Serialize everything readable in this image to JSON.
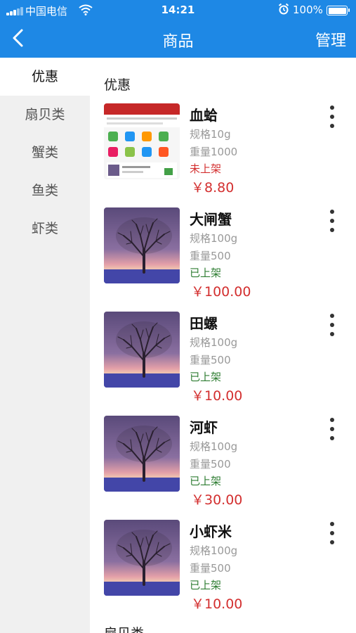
{
  "status_bar": {
    "carrier": "中国电信",
    "time": "14:21",
    "battery": "100%"
  },
  "nav": {
    "title": "商品",
    "manage_label": "管理"
  },
  "sidebar": {
    "categories": [
      {
        "label": "优惠",
        "active": true
      },
      {
        "label": "扇贝类",
        "active": false
      },
      {
        "label": "蟹类",
        "active": false
      },
      {
        "label": "鱼类",
        "active": false
      },
      {
        "label": "虾类",
        "active": false
      }
    ]
  },
  "main": {
    "section_title": "优惠",
    "next_section_title": "扇贝类",
    "products": [
      {
        "name": "血蛤",
        "spec": "规格10g",
        "weight": "重量1000",
        "status": "未上架",
        "status_color": "#d32f2f",
        "price": "￥8.80",
        "thumb": "screenshot"
      },
      {
        "name": "大闸蟹",
        "spec": "规格100g",
        "weight": "重量500",
        "status": "已上架",
        "status_color": "#2e7d32",
        "price": "￥100.00",
        "thumb": "tree"
      },
      {
        "name": "田螺",
        "spec": "规格100g",
        "weight": "重量500",
        "status": "已上架",
        "status_color": "#2e7d32",
        "price": "￥10.00",
        "thumb": "tree"
      },
      {
        "name": "河虾",
        "spec": "规格100g",
        "weight": "重量500",
        "status": "已上架",
        "status_color": "#2e7d32",
        "price": "￥30.00",
        "thumb": "tree"
      },
      {
        "name": "小虾米",
        "spec": "规格100g",
        "weight": "重量500",
        "status": "已上架",
        "status_color": "#2e7d32",
        "price": "￥10.00",
        "thumb": "tree"
      }
    ]
  },
  "colors": {
    "accent": "#1e88e5",
    "price": "#d32f2f",
    "listed": "#2e7d32",
    "unlisted": "#d32f2f"
  },
  "icons": {
    "back": "chevron-left-icon",
    "more": "more-vertical-icon",
    "wifi": "wifi-icon",
    "alarm": "alarm-icon",
    "battery": "battery-icon",
    "signal": "signal-icon"
  }
}
